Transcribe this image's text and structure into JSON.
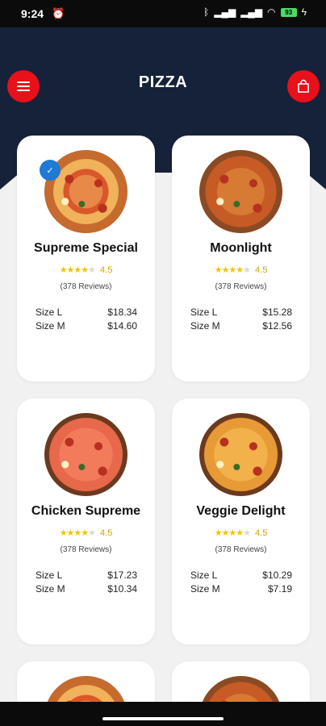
{
  "status_bar": {
    "time": "9:24",
    "icons": [
      "alarm-off-icon",
      "bluetooth-icon",
      "signal-icon",
      "signal-icon",
      "wifi-icon",
      "battery-icon",
      "charging-icon"
    ],
    "battery_level": "93"
  },
  "header": {
    "title": "PIZZA",
    "menu_icon": "hamburger-menu-icon",
    "cart_icon": "shopping-bag-icon",
    "accent_color": "#e8101b",
    "background_color": "#152239"
  },
  "products": [
    {
      "name": "Supreme Special",
      "rating": "4.5",
      "stars": 4,
      "reviews": "(378 Reviews)",
      "size_l_label": "Size L",
      "size_l_price": "$18.34",
      "size_m_label": "Size M",
      "size_m_price": "$14.60"
    },
    {
      "name": "Moonlight",
      "rating": "4.5",
      "stars": 4,
      "reviews": "(378 Reviews)",
      "size_l_label": "Size L",
      "size_l_price": "$15.28",
      "size_m_label": "Size M",
      "size_m_price": "$12.56"
    },
    {
      "name": "Chicken Supreme",
      "rating": "4.5",
      "stars": 4,
      "reviews": "(378 Reviews)",
      "size_l_label": "Size L",
      "size_l_price": "$17.23",
      "size_m_label": "Size M",
      "size_m_price": "$10.34"
    },
    {
      "name": "Veggie Delight",
      "rating": "4.5",
      "stars": 4,
      "reviews": "(378 Reviews)",
      "size_l_label": "Size L",
      "size_l_price": "$10.29",
      "size_m_label": "Size M",
      "size_m_price": "$7.19"
    }
  ]
}
